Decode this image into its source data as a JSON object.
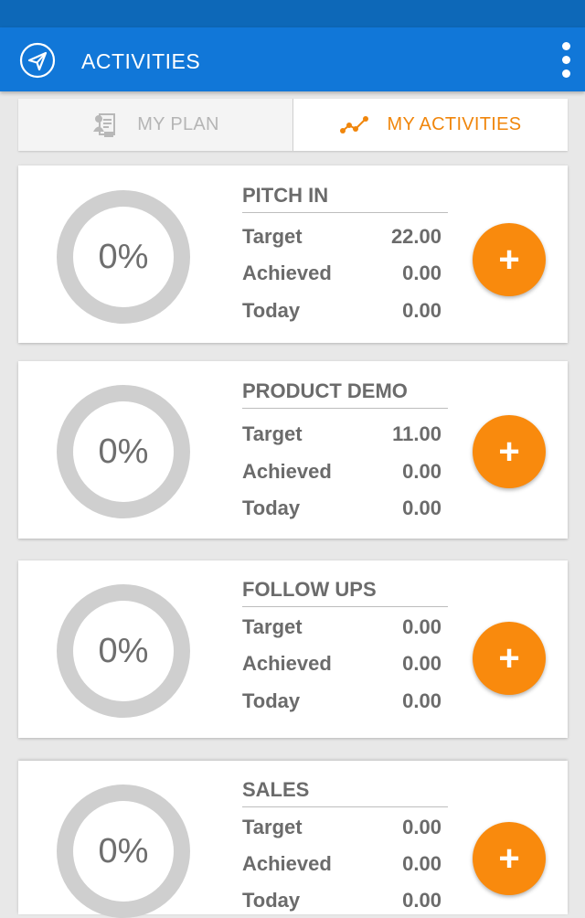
{
  "app_bar": {
    "title": "ACTIVITIES",
    "nav_icon": "paper-plane-icon",
    "menu_icon": "more-vert-icon"
  },
  "tabs": [
    {
      "label": "MY PLAN",
      "icon": "plan-document-icon",
      "active": false
    },
    {
      "label": "MY ACTIVITIES",
      "icon": "activity-graph-icon",
      "active": true
    }
  ],
  "colors": {
    "status_bar": "#0d68b8",
    "app_bar": "#1177d8",
    "accent": "#f98a0d",
    "ring": "#cfcfcf",
    "text": "#6b6b6b"
  },
  "activities": [
    {
      "name": "PITCH IN",
      "percent_label": "0%",
      "progress": 0,
      "stats": [
        {
          "label": "Target",
          "value": "22.00"
        },
        {
          "label": "Achieved",
          "value": "0.00"
        },
        {
          "label": "Today",
          "value": "0.00"
        }
      ],
      "add_label": "+"
    },
    {
      "name": "PRODUCT DEMO",
      "percent_label": "0%",
      "progress": 0,
      "stats": [
        {
          "label": "Target",
          "value": "11.00"
        },
        {
          "label": "Achieved",
          "value": "0.00"
        },
        {
          "label": "Today",
          "value": "0.00"
        }
      ],
      "add_label": "+"
    },
    {
      "name": "FOLLOW UPS",
      "percent_label": "0%",
      "progress": 0,
      "stats": [
        {
          "label": "Target",
          "value": "0.00"
        },
        {
          "label": "Achieved",
          "value": "0.00"
        },
        {
          "label": "Today",
          "value": "0.00"
        }
      ],
      "add_label": "+"
    },
    {
      "name": "SALES",
      "percent_label": "0%",
      "progress": 0,
      "stats": [
        {
          "label": "Target",
          "value": "0.00"
        },
        {
          "label": "Achieved",
          "value": "0.00"
        },
        {
          "label": "Today",
          "value": "0.00"
        }
      ],
      "add_label": "+"
    }
  ]
}
